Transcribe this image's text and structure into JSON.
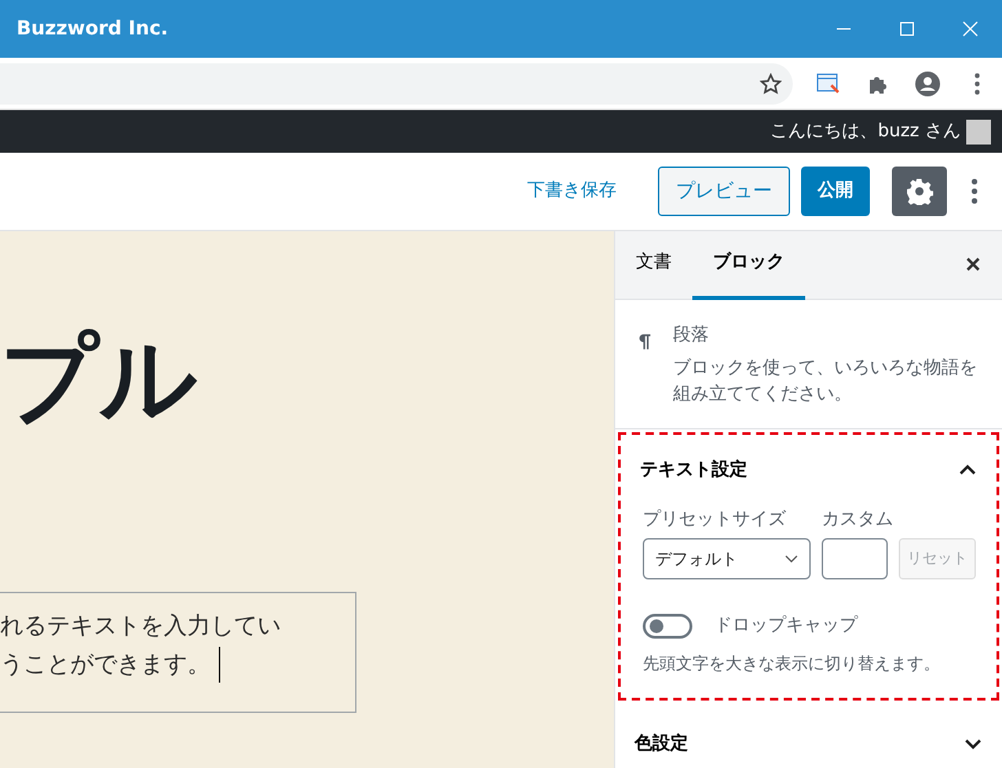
{
  "window": {
    "title": "Buzzword Inc."
  },
  "admin_bar": {
    "greeting": "こんにちは、buzz さん"
  },
  "editor_header": {
    "save_draft": "下書き保存",
    "preview": "プレビュー",
    "publish": "公開",
    "settings_selected": true
  },
  "canvas": {
    "title": "プル",
    "paragraph_lines": [
      "れるテキストを入力してい",
      "うことができます。"
    ]
  },
  "sidebar": {
    "tabs": [
      {
        "label": "文書",
        "selected": false
      },
      {
        "label": "ブロック",
        "selected": true
      }
    ],
    "block": {
      "name": "段落",
      "description": "ブロックを使って、いろいろな物語を組み立ててください。"
    },
    "panels": [
      {
        "title": "テキスト設定",
        "expanded": true,
        "highlighted": true,
        "preset_label": "プリセットサイズ",
        "preset_value": "デフォルト",
        "custom_label": "カスタム",
        "reset": "リセット",
        "reset_disabled": true,
        "dropcap_label": "ドロップキャップ",
        "dropcap_on": false,
        "dropcap_help": "先頭文字を大きな表示に切り替えます。"
      },
      {
        "title": "色設定",
        "expanded": false,
        "highlighted": false
      }
    ]
  }
}
